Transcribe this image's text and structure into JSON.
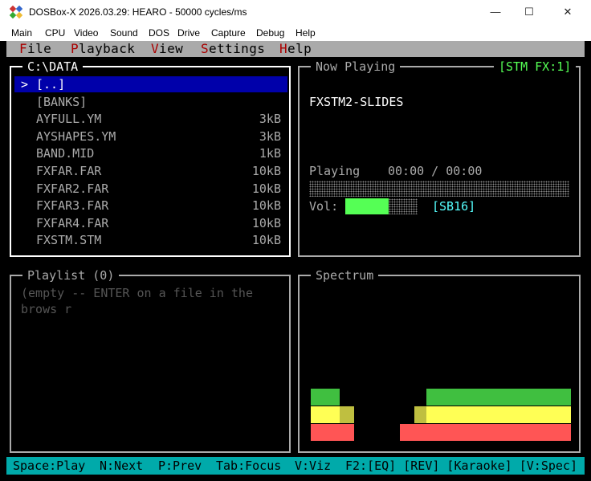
{
  "window": {
    "title": "DOSBox-X 2026.03.29: HEARO - 50000 cycles/ms",
    "icon": "dosbox-icon"
  },
  "host_menu": [
    "Main",
    "CPU",
    "Video",
    "Sound",
    "DOS",
    "Drive",
    "Capture",
    "Debug",
    "Help"
  ],
  "app_menu": [
    {
      "hotkey": "F",
      "rest": "ile"
    },
    {
      "hotkey": "P",
      "rest": "layback"
    },
    {
      "hotkey": "V",
      "rest": "iew"
    },
    {
      "hotkey": "S",
      "rest": "ettings"
    },
    {
      "hotkey": "H",
      "rest": "elp"
    }
  ],
  "browser": {
    "title": "C:\\DATA",
    "selected_marker": ">",
    "files": [
      {
        "name": "[..]",
        "size": "",
        "selected": true
      },
      {
        "name": "[BANKS]",
        "size": "",
        "selected": false
      },
      {
        "name": "AYFULL.YM",
        "size": "3kB",
        "selected": false
      },
      {
        "name": "AYSHAPES.YM",
        "size": "3kB",
        "selected": false
      },
      {
        "name": "BAND.MID",
        "size": "1kB",
        "selected": false
      },
      {
        "name": "FXFAR.FAR",
        "size": "10kB",
        "selected": false
      },
      {
        "name": "FXFAR2.FAR",
        "size": "10kB",
        "selected": false
      },
      {
        "name": "FXFAR3.FAR",
        "size": "10kB",
        "selected": false
      },
      {
        "name": "FXFAR4.FAR",
        "size": "10kB",
        "selected": false
      },
      {
        "name": "FXSTM.STM",
        "size": "10kB",
        "selected": false
      }
    ]
  },
  "now_playing": {
    "title": "Now Playing",
    "badge": "[STM FX:1]",
    "track": "FXSTM2-SLIDES",
    "state": "Playing",
    "time": "00:00 / 00:00",
    "progress": 0,
    "volume_label": "Vol:",
    "volume": 0.6,
    "device": "[SB16]"
  },
  "playlist": {
    "title": "Playlist (0)",
    "empty_text": "(empty -- ENTER on a file in the brows r"
  },
  "spectrum": {
    "title": "Spectrum",
    "colors": {
      "low": "#ff5555",
      "mid": "#ffff55",
      "high": "#55ff55"
    },
    "bars": [
      3,
      3,
      3,
      3,
      3,
      3,
      3,
      3,
      3,
      3,
      3,
      3,
      2,
      2,
      2,
      2,
      2,
      2,
      0,
      0,
      0,
      0,
      0,
      0,
      0,
      0,
      0,
      0,
      0,
      0,
      0,
      0,
      0,
      0,
      0,
      0,
      0,
      1,
      1,
      1,
      1,
      1,
      1,
      2,
      2,
      2,
      2,
      2,
      3,
      3,
      3,
      3,
      3,
      3,
      3,
      3,
      3,
      3,
      3,
      3,
      3,
      3,
      3,
      3,
      3,
      3,
      3,
      3,
      3,
      3,
      3,
      3,
      3,
      3,
      3,
      3,
      3,
      3,
      3,
      3,
      3,
      3,
      3,
      3,
      3,
      3,
      3,
      3,
      3,
      3,
      3,
      3,
      3,
      3,
      3,
      3,
      3,
      3,
      3,
      3,
      3,
      3,
      3,
      3,
      3,
      3,
      3,
      3
    ]
  },
  "status": [
    {
      "text": "Space:Play"
    },
    {
      "text": "N:Next"
    },
    {
      "text": "P:Prev"
    },
    {
      "text": "Tab:Focus"
    },
    {
      "text": "V:Viz"
    },
    {
      "text": "F2:[EQ] [REV] [Karaoke] [V:Spec]"
    }
  ]
}
